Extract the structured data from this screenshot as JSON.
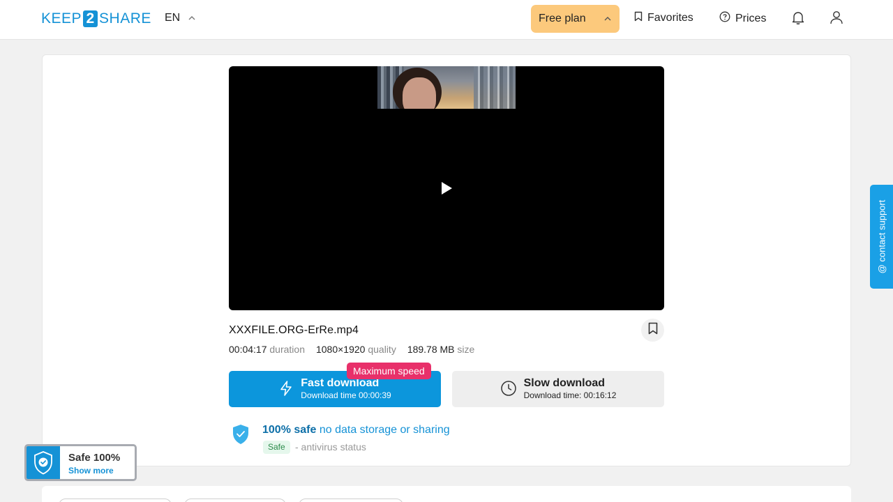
{
  "header": {
    "logo_left": "KEEP",
    "logo_digit": "2",
    "logo_right": "SHARE",
    "lang": "EN",
    "plan_label": "Free plan",
    "favorites_label": "Favorites",
    "prices_label": "Prices"
  },
  "file": {
    "name": "XXXFILE.ORG-ErRe.mp4",
    "duration": "00:04:17",
    "duration_label": "duration",
    "resolution": "1080×1920",
    "resolution_label": "quality",
    "size": "189.78 MB",
    "size_label": "size"
  },
  "download": {
    "fast_title": "Fast download",
    "fast_sub": "Download time 00:00:39",
    "badge": "Maximum speed",
    "slow_title": "Slow download",
    "slow_sub": "Download time: 00:16:12"
  },
  "safety": {
    "title_bold": "100% safe",
    "title_rest": "no data storage or sharing",
    "badge": "Safe",
    "status": "- antivirus status"
  },
  "support_label": "@ contact support",
  "safe_widget": {
    "title": "Safe 100%",
    "link": "Show more"
  },
  "colors": {
    "brand": "#1592d6",
    "plan": "#fcc97c",
    "badge": "#e8306a"
  }
}
